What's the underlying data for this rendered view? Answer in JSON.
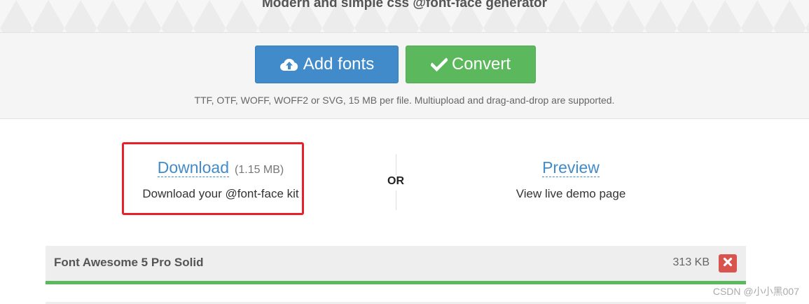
{
  "header": {
    "subtitle": "Modern and simple css @font-face generator"
  },
  "upload": {
    "add_fonts_label": "Add fonts",
    "convert_label": "Convert",
    "hint": "TTF, OTF, WOFF, WOFF2 or SVG, 15 MB per file. Multiupload and drag-and-drop are supported."
  },
  "result": {
    "download": {
      "label": "Download",
      "size": "(1.15 MB)",
      "description": "Download your @font-face kit"
    },
    "or_label": "OR",
    "preview": {
      "label": "Preview",
      "description": "View live demo page"
    }
  },
  "fonts": [
    {
      "name": "Font Awesome 5 Pro Solid",
      "size": "313 KB",
      "progress_percent": 100
    }
  ],
  "icons": {
    "add": "cloud-upload-icon",
    "convert": "check-icon",
    "remove": "close-icon"
  },
  "colors": {
    "primary": "#428bca",
    "success": "#5cb85c",
    "danger": "#d9534f",
    "highlight": "#e8202a"
  },
  "watermark": "CSDN @小小黑007"
}
